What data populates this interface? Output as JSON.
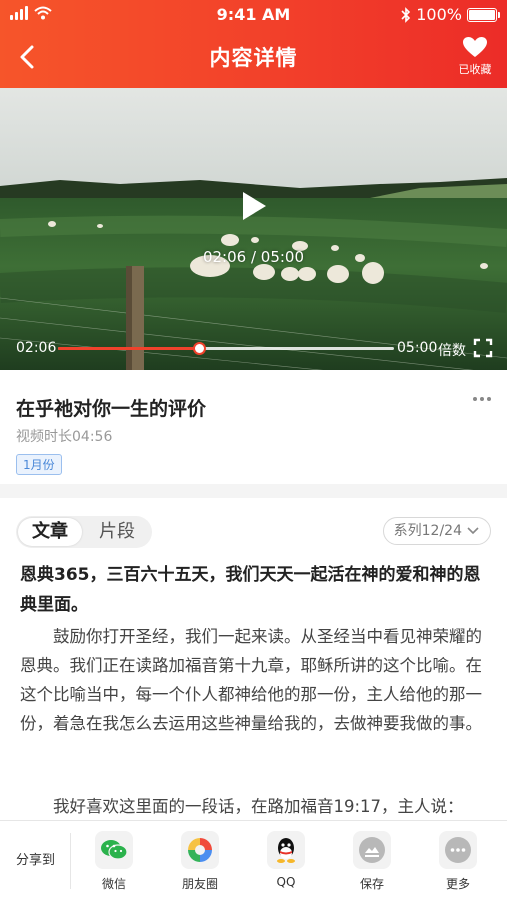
{
  "status_bar": {
    "time": "9:41 AM",
    "battery": "100%"
  },
  "nav": {
    "title": "内容详情",
    "favorite_label": "已收藏"
  },
  "video": {
    "current_time": "02:06",
    "duration": "05:00",
    "center_time": "02:06 / 05:00",
    "speed_label": "倍数",
    "progress": 0.42
  },
  "content": {
    "title": "在乎祂对你一生的评价",
    "duration_text": "视频时长04:56",
    "tag": "1月份"
  },
  "article": {
    "tabs": [
      "文章",
      "片段"
    ],
    "series_label": "系列12/24",
    "lead": "恩典365，三百六十五天，我们天天一起活在神的爱和神的恩典里面。",
    "paragraphs": [
      "鼓励你打开圣经，我们一起来读。从圣经当中看见神荣耀的恩典。我们正在读路加福音第十九章，耶稣所讲的这个比喻。在这个比喻当中，每一个仆人都神给他的那一份，主人给他的那一份，着急在我怎么去运用这些神量给我的，去做神要我做的事。",
      "我好喜欢这里面的一段话，在路加福音19:17，主人说："
    ]
  },
  "share": {
    "label": "分享到",
    "items": [
      {
        "label": "微信",
        "icon": "wechat-icon"
      },
      {
        "label": "朋友圈",
        "icon": "moments-icon"
      },
      {
        "label": "QQ",
        "icon": "qq-icon"
      },
      {
        "label": "保存",
        "icon": "save-icon"
      },
      {
        "label": "更多",
        "icon": "more-icon"
      }
    ]
  },
  "colors": {
    "accent": "#f0422c",
    "tag_blue": "#4a88d8"
  }
}
